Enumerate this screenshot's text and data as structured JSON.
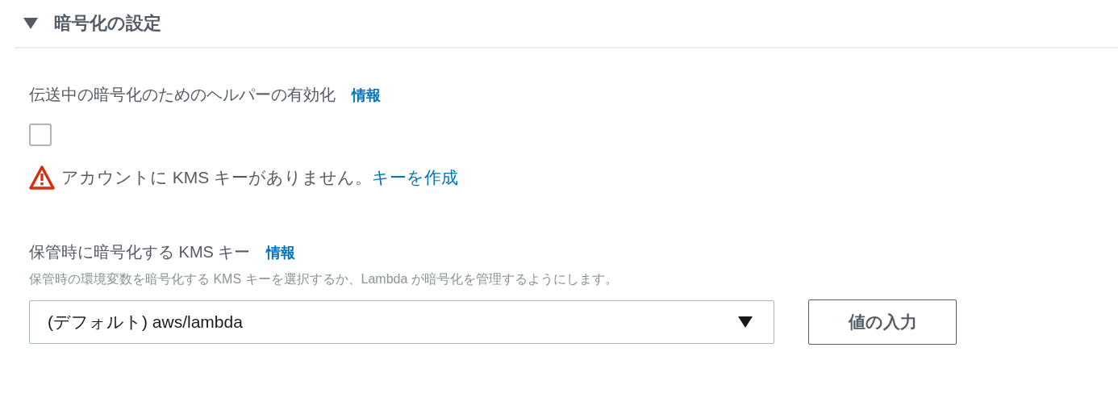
{
  "section": {
    "title": "暗号化の設定",
    "expanded": true
  },
  "helper": {
    "label": "伝送中の暗号化のためのヘルパーの有効化",
    "info": "情報",
    "checked": false
  },
  "warning": {
    "text": "アカウントに KMS キーがありません。",
    "link": "キーを作成"
  },
  "kms": {
    "label": "保管時に暗号化する KMS キー",
    "info": "情報",
    "description": "保管時の環境変数を暗号化する KMS キーを選択するか、Lambda が暗号化を管理するようにします。",
    "value": "(デフォルト) aws/lambda",
    "button": "値の入力"
  }
}
